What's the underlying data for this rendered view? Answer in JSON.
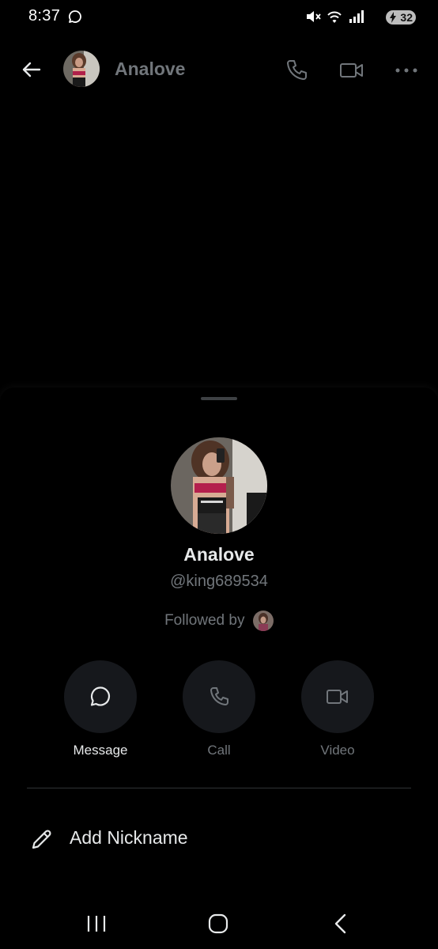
{
  "status_bar": {
    "time": "8:37",
    "battery_level": "32",
    "icons": [
      "chat-bubble-icon",
      "mute-icon",
      "wifi-icon",
      "signal-icon",
      "battery-charging-icon"
    ]
  },
  "header": {
    "name": "Analove",
    "icons": [
      "back-arrow-icon",
      "phone-icon",
      "video-icon",
      "more-icon"
    ]
  },
  "profile": {
    "name": "Analove",
    "handle": "@king689534",
    "followed_by": "Followed by"
  },
  "actions": [
    {
      "label": "Message",
      "icon": "message-bubble-icon",
      "enabled": true
    },
    {
      "label": "Call",
      "icon": "phone-icon",
      "enabled": false
    },
    {
      "label": "Video",
      "icon": "video-icon",
      "enabled": false
    }
  ],
  "nickname": {
    "label": "Add Nickname",
    "icon": "pencil-icon"
  },
  "nav": {
    "icons": [
      "recents-icon",
      "home-icon",
      "back-icon"
    ]
  },
  "colors": {
    "background": "#000000",
    "primary_text": "#e7e9ea",
    "secondary_text": "#71767b",
    "action_circle": "#16181c",
    "divider": "#2f3336"
  }
}
